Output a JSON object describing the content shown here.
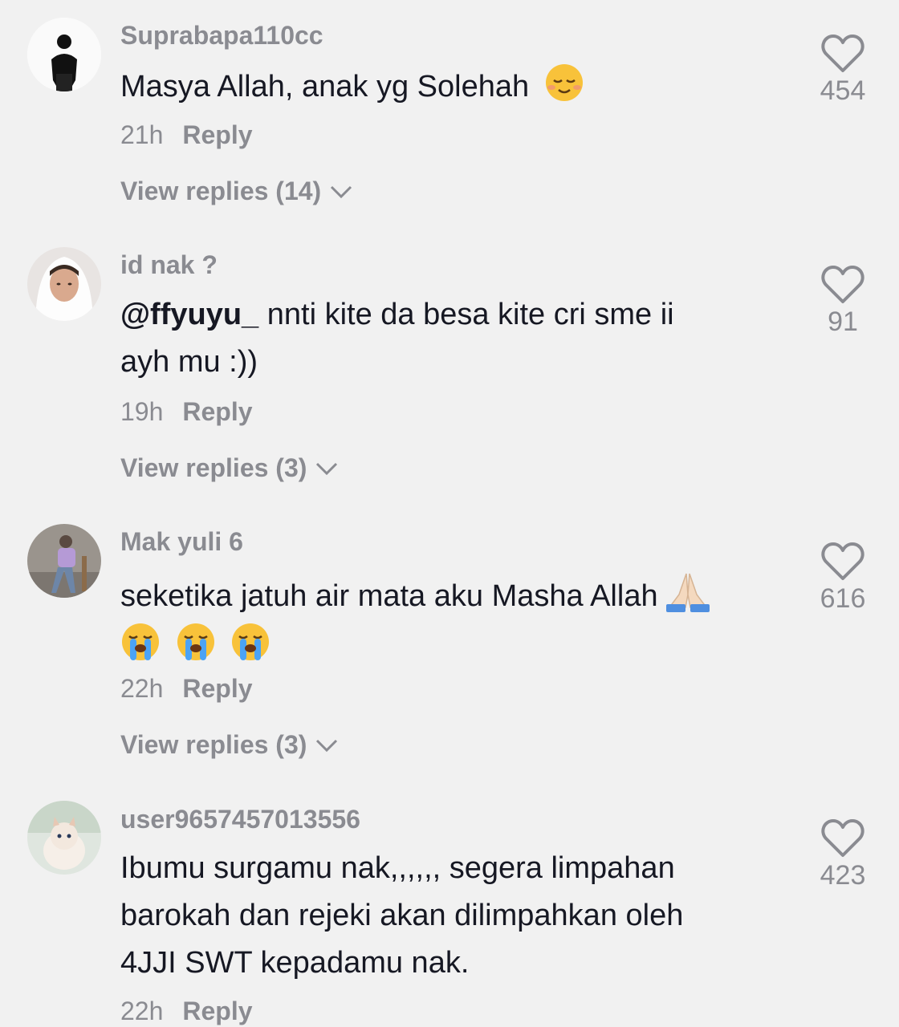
{
  "colors": {
    "background": "#f1f1f1",
    "text": "#161823",
    "muted": "#8a8b91"
  },
  "comments": [
    {
      "username": "Suprabapa110cc",
      "text_lines": [
        "Masya Allah, anak yg Solehah"
      ],
      "emoji": [
        "relieved-smiling-face"
      ],
      "time": "21h",
      "reply_label": "Reply",
      "view_replies": "View replies (14)",
      "likes": "454"
    },
    {
      "username": "id nak ?",
      "mention": "@ffyuyu_",
      "text_lines": [
        " nnti kite da besa kite cri sme ii",
        "ayh mu :))"
      ],
      "time": "19h",
      "reply_label": "Reply",
      "view_replies": "View replies (3)",
      "likes": "91"
    },
    {
      "username": "Mak yuli 6",
      "text_lines": [
        "seketika jatuh air mata aku Masha Allah"
      ],
      "emoji": [
        "folded-hands",
        "loudly-crying-face",
        "loudly-crying-face",
        "loudly-crying-face"
      ],
      "time": "22h",
      "reply_label": "Reply",
      "view_replies": "View replies (3)",
      "likes": "616"
    },
    {
      "username": "user9657457013556",
      "text_lines": [
        "Ibumu surgamu nak,,,,,, segera limpahan",
        "barokah dan rejeki akan dilimpahkan oleh",
        "4JJI SWT kepadamu nak."
      ],
      "time": "22h",
      "reply_label": "Reply",
      "likes": "423"
    }
  ]
}
